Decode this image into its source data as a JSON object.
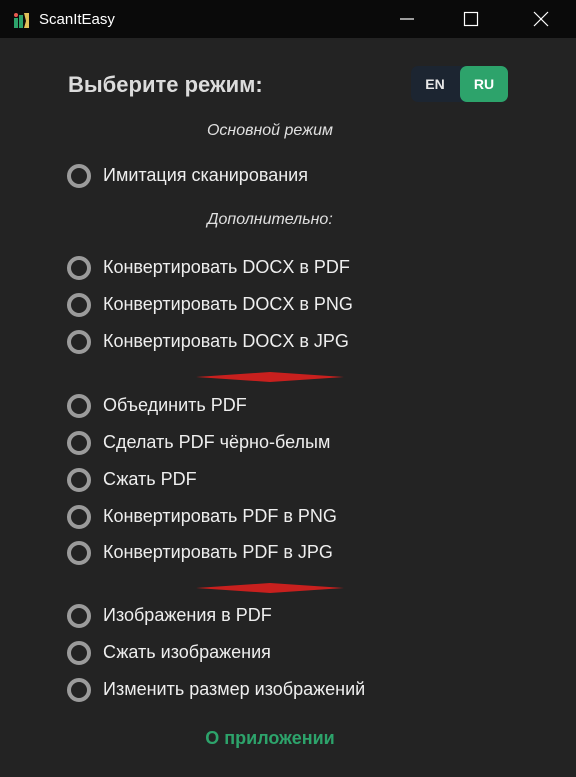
{
  "window": {
    "title": "ScanItEasy"
  },
  "heading": "Выберите режим:",
  "language": {
    "options": [
      "EN",
      "RU"
    ],
    "selected": "RU",
    "accent_color": "#2da36b"
  },
  "sections": {
    "main_label": "Основной режим",
    "extra_label": "Дополнительно:"
  },
  "options": {
    "main": [
      "Имитация сканирования"
    ],
    "docx": [
      "Конвертировать DOCX в PDF",
      "Конвертировать DOCX в PNG",
      "Конвертировать DOCX в JPG"
    ],
    "pdf": [
      "Объединить PDF",
      "Сделать PDF чёрно-белым",
      "Сжать PDF",
      "Конвертировать PDF в PNG",
      "Конвертировать PDF в JPG"
    ],
    "images": [
      "Изображения в PDF",
      "Сжать изображения",
      "Изменить размер изображений"
    ]
  },
  "divider_color": "#c8201e",
  "about_link": "О приложении"
}
